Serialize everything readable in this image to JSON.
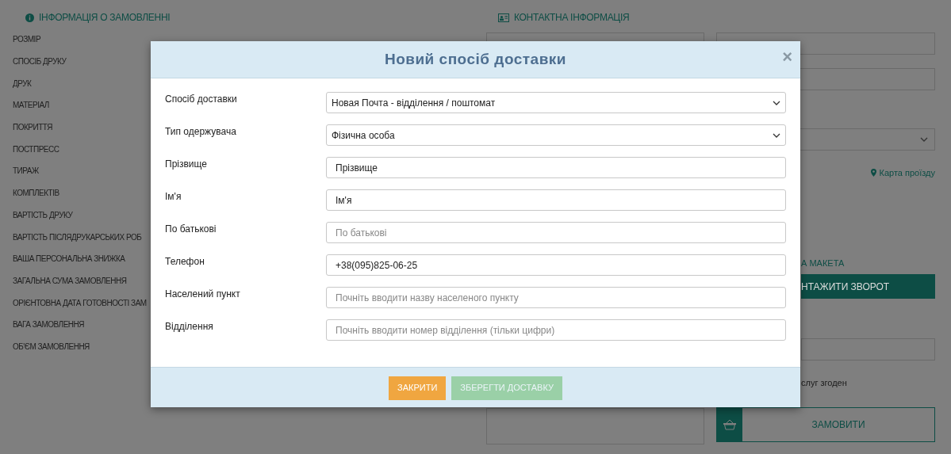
{
  "order_info": {
    "title": "ІНФОРМАЦІЯ О ЗАМОВЛЕННІ",
    "labels": [
      "РОЗМІР",
      "СПОСІБ ДРУКУ",
      "ДРУК",
      "МАТЕРІАЛ",
      "ПОКРИТТЯ",
      "ПОСТПРЕСС",
      "ТИРАЖ",
      "КОМПЛЕКТІВ",
      "ВАРТІСТЬ ДРУКУ",
      "ВАРТІСТЬ ПІСЛЯДРУКАРСЬКИХ РОБ",
      "ВАША ПЕРСОНАЛЬНА ЗНИЖКА",
      "ЗАГАЛЬНА СУМА ЗАМОВЛЕННЯ",
      "ОРІЄНТОВНА ДАТА ГОТОВНОСТІ ЗАМ",
      "ВАГА ЗАМОВЛЕННЯ",
      "ОБ'ЄМ ЗАМОВЛЕННЯ"
    ]
  },
  "contact_info": {
    "title": "КОНТАКТНА ІНФОРМАЦІЯ",
    "map_link": "Карта проїзду",
    "layout_heading": "А МАКЕТА",
    "upload_button": "НТАЖИТИ ЗВОРОТ",
    "agree_text": "слуг згоден",
    "order_button": "ЗАМОВИТИ"
  },
  "dialog": {
    "title": "Новий спосіб доставки",
    "close": "×",
    "fields": [
      {
        "label": "Спосіб доставки",
        "kind": "select",
        "value": "Новая Почта - відділення / поштомат"
      },
      {
        "label": "Тип одержувача",
        "kind": "select",
        "value": "Фізична особа"
      },
      {
        "label": "Прізвище",
        "kind": "input",
        "value": "Прізвище"
      },
      {
        "label": "Ім'я",
        "kind": "input",
        "value": "Ім'я"
      },
      {
        "label": "По батькові",
        "kind": "input",
        "placeholder": "По батькові"
      },
      {
        "label": "Телефон",
        "kind": "input",
        "value": "+38(095)825-06-25"
      },
      {
        "label": "Населений пункт",
        "kind": "input",
        "placeholder": "Почніть вводити назву населеного пункту"
      },
      {
        "label": "Відділення",
        "kind": "input",
        "placeholder": "Почніть вводити номер відділення (тільки цифри)"
      }
    ],
    "buttons": [
      {
        "label": "ЗАКРИТИ",
        "kind": "close",
        "disabled": false
      },
      {
        "label": "ЗБЕРЕГТИ ДОСТАВКУ",
        "kind": "save",
        "disabled": true
      }
    ]
  }
}
